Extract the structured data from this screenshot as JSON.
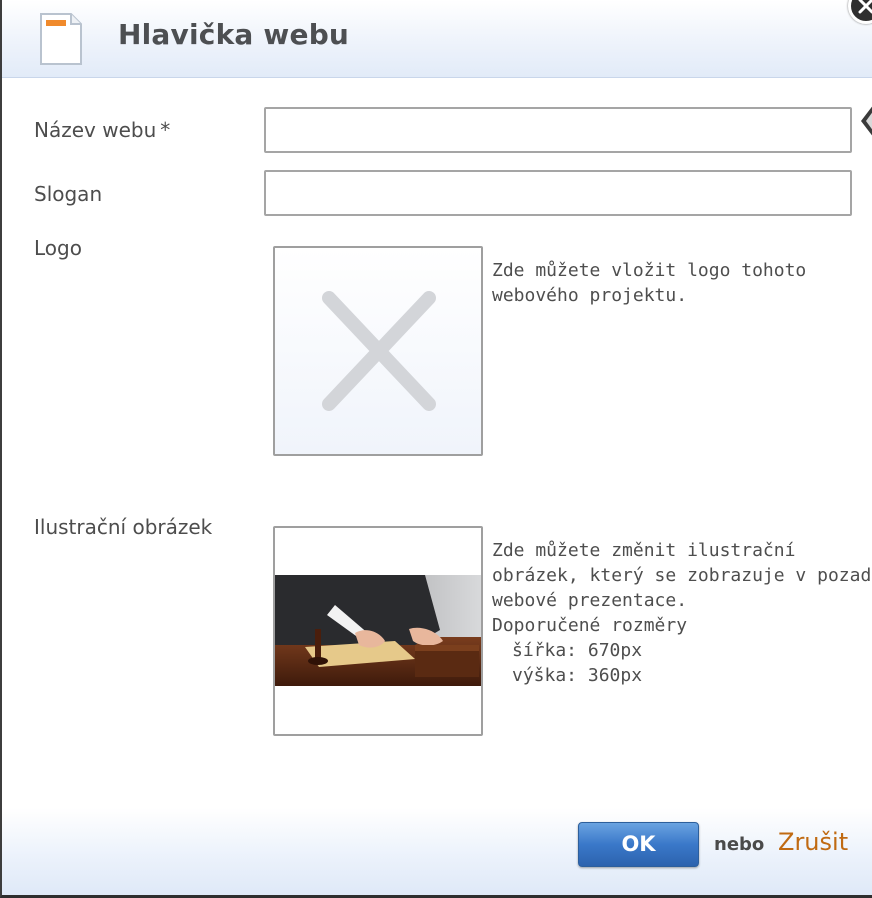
{
  "dialog": {
    "title": "Hlavička webu",
    "icons": {
      "title_icon": "document-icon",
      "close_icon": "close-icon"
    }
  },
  "form": {
    "name": {
      "label": "Název webu",
      "required_mark": "*",
      "value": ""
    },
    "slogan": {
      "label": "Slogan",
      "value": ""
    },
    "logo": {
      "label": "Logo",
      "placeholder_icon": "no-image-icon",
      "help": [
        "Zde můžete vložit logo tohoto",
        "webového projektu."
      ]
    },
    "illustration": {
      "label": "Ilustrační obrázek",
      "help": [
        "Zde můžete změnit ilustrační",
        "obrázek, který se zobrazuje v pozadí",
        "webové prezentace.",
        "Doporučené rozměry"
      ],
      "width": "šířka: 670px",
      "height": "výška: 360px"
    }
  },
  "footer": {
    "ok_label": "OK",
    "or_label": "nebo",
    "cancel_label": "Zrušit"
  },
  "colors": {
    "accent_button": "#3a78c9",
    "cancel_link": "#c06a12",
    "header_gradient": "#e2ebf8"
  }
}
